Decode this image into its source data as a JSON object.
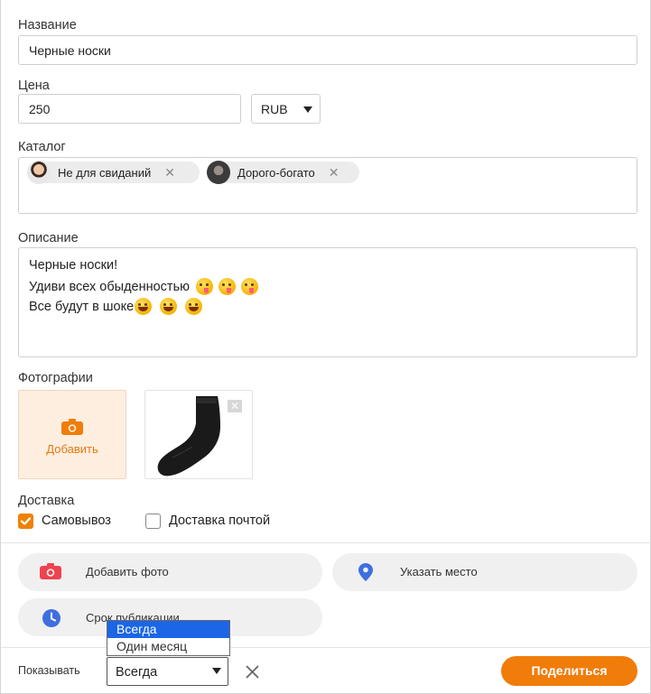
{
  "form": {
    "name_label": "Название",
    "name_value": "Черные носки",
    "price_label": "Цена",
    "price_value": "250",
    "currency_value": "RUB",
    "catalog_label": "Каталог",
    "catalog_chips": [
      {
        "label": "Не для свиданий",
        "remove": "✕"
      },
      {
        "label": "Дорого-богато",
        "remove": "✕"
      }
    ],
    "description_label": "Описание",
    "description_lines": [
      "Черные носки!",
      "Удиви всех обыденностью",
      "Все будут в шоке"
    ],
    "photos_label": "Фотографии",
    "add_photo_label": "Добавить",
    "thumb_remove": "✕",
    "delivery_label": "Доставка",
    "delivery_options": [
      {
        "label": "Самовывоз",
        "checked": true
      },
      {
        "label": "Доставка почтой",
        "checked": false
      }
    ]
  },
  "actions": {
    "add_photo": "Добавить фото",
    "set_place": "Указать место",
    "publish_term": "Срок публикации"
  },
  "footer": {
    "show_label": "Показывать",
    "show_value": "Всегда",
    "clear_icon": "✕",
    "share_label": "Поделиться",
    "dropdown_options": [
      {
        "label": "Всегда",
        "selected": true
      },
      {
        "label": "Один месяц",
        "selected": false
      }
    ]
  },
  "colors": {
    "accent": "#f07c0a",
    "add_tile_bg": "#fdeee0",
    "dropdown_selected": "#1b66e6"
  },
  "icons": [
    "camera-icon",
    "map-pin-icon",
    "clock-icon",
    "close-icon",
    "dropdown-caret-icon",
    "emoji-wink-icon",
    "emoji-smile-icon",
    "checkmark-icon"
  ]
}
